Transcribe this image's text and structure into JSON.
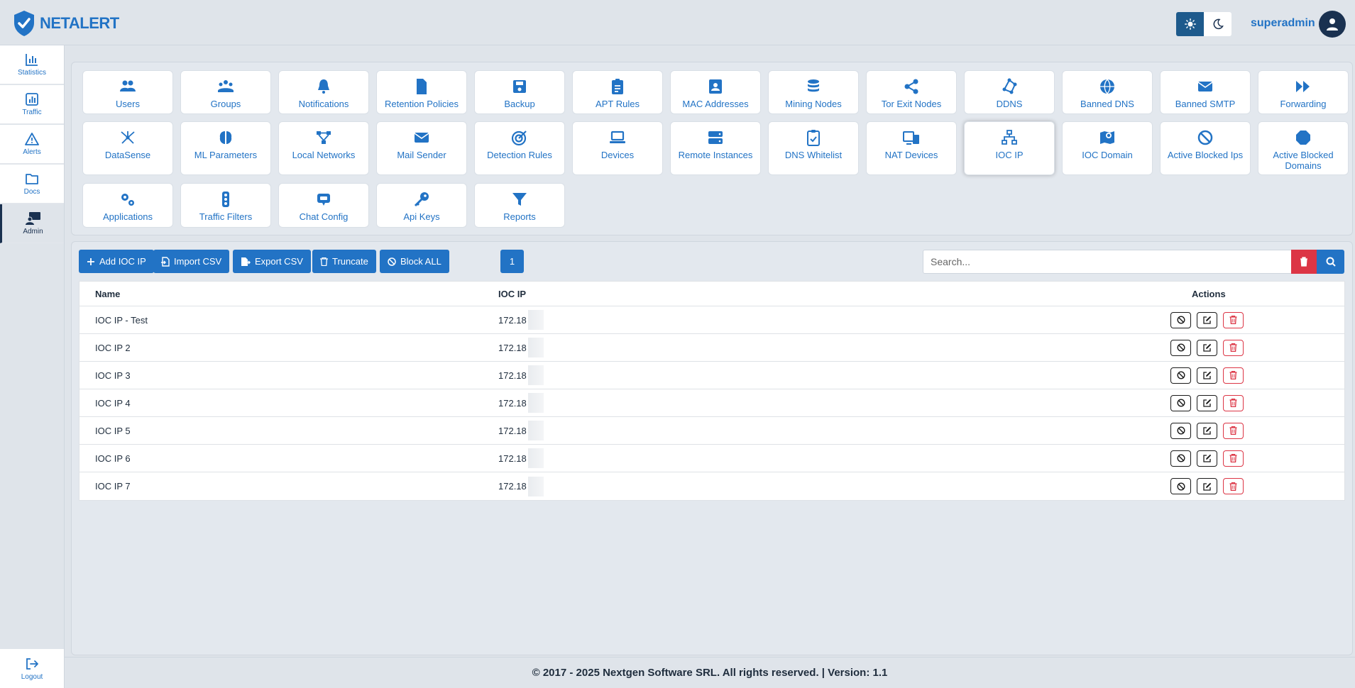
{
  "app": {
    "brand": "NETALERT"
  },
  "header": {
    "username": "superadmin",
    "theme_light_icon": "sun-icon",
    "theme_dark_icon": "moon-icon"
  },
  "sidebar": {
    "items": [
      {
        "label": "Statistics",
        "icon": "bar-chart-icon"
      },
      {
        "label": "Traffic",
        "icon": "chart-square-icon"
      },
      {
        "label": "Alerts",
        "icon": "warning-icon"
      },
      {
        "label": "Docs",
        "icon": "folder-icon"
      },
      {
        "label": "Admin",
        "icon": "admin-icon"
      }
    ],
    "logout": "Logout"
  },
  "tiles": [
    "Users",
    "Groups",
    "Notifications",
    "Retention Policies",
    "Backup",
    "APT Rules",
    "MAC Addresses",
    "Mining Nodes",
    "Tor Exit Nodes",
    "DDNS",
    "Banned DNS",
    "Banned SMTP",
    "Forwarding",
    "DataSense",
    "ML Parameters",
    "Local Networks",
    "Mail Sender",
    "Detection Rules",
    "Devices",
    "Remote Instances",
    "DNS Whitelist",
    "NAT Devices",
    "IOC IP",
    "IOC Domain",
    "Active Blocked Ips",
    "Active Blocked Domains",
    "Applications",
    "Traffic Filters",
    "Chat Config",
    "Api Keys",
    "Reports"
  ],
  "toolbar": {
    "add": "Add IOC IP",
    "import": "Import CSV",
    "export": "Export CSV",
    "truncate": "Truncate",
    "block_all": "Block ALL",
    "page": "1",
    "search_placeholder": "Search..."
  },
  "table": {
    "headers": {
      "name": "Name",
      "ip": "IOC IP",
      "actions": "Actions"
    },
    "rows": [
      {
        "name": "IOC IP - Test",
        "ip": "172.18"
      },
      {
        "name": "IOC IP 2",
        "ip": "172.18"
      },
      {
        "name": "IOC IP 3",
        "ip": "172.18"
      },
      {
        "name": "IOC IP 4",
        "ip": "172.18"
      },
      {
        "name": "IOC IP 5",
        "ip": "172.18"
      },
      {
        "name": "IOC IP 6",
        "ip": "172.18"
      },
      {
        "name": "IOC IP 7",
        "ip": "172.18"
      }
    ]
  },
  "footer": {
    "text": "© 2017 - 2025 Nextgen Software SRL. All rights reserved. | Version: 1.1"
  },
  "colors": {
    "primary": "#2273c5",
    "danger": "#dc3545",
    "dark": "#1a3150"
  }
}
